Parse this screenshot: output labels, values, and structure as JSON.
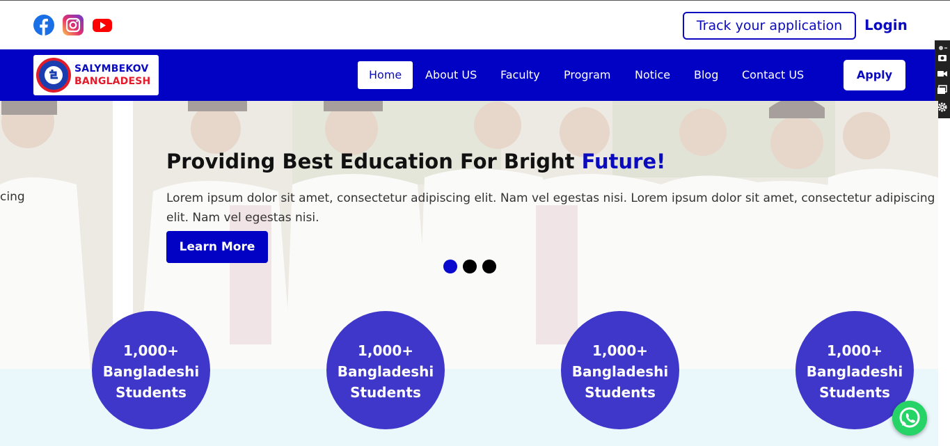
{
  "topbar": {
    "social": [
      "facebook-icon",
      "instagram-icon",
      "youtube-icon"
    ],
    "track_label": "Track your application",
    "login_label": "Login"
  },
  "nav": {
    "logo_line1": "SALYMBEKOV",
    "logo_line2": "BANGLADESH",
    "logo_seal_text": "SALYMBEKOV UNIVERSITY",
    "items": [
      {
        "label": "Home",
        "active": true
      },
      {
        "label": "About US"
      },
      {
        "label": "Faculty"
      },
      {
        "label": "Program"
      },
      {
        "label": "Notice"
      },
      {
        "label": "Blog"
      },
      {
        "label": "Contact US"
      }
    ],
    "apply_label": "Apply"
  },
  "hero": {
    "prev_slide_text": "cing",
    "title_main": "Providing Best Education For Bright",
    "title_accent": "Future!",
    "text": "Lorem ipsum dolor sit amet, consectetur adipiscing elit. Nam vel egestas nisi. Lorem ipsum dolor sit amet, consectetur adipiscing elit. Nam vel egestas nisi.",
    "cta_label": "Learn More",
    "slide_count": 3,
    "active_slide": 1
  },
  "stats": [
    {
      "number": "1,000+",
      "label": "Bangladeshi Students"
    },
    {
      "number": "1,000+",
      "label": "Bangladeshi Students"
    },
    {
      "number": "1,000+",
      "label": "Bangladeshi Students"
    },
    {
      "number": "1,000+",
      "label": "Bangladeshi Students"
    }
  ],
  "colors": {
    "brand_blue": "#0202c4",
    "stat_circle": "#3e37c9",
    "stats_band": "#eaf8fc",
    "logo_red": "#e21b2a",
    "whatsapp_green": "#25d366"
  }
}
